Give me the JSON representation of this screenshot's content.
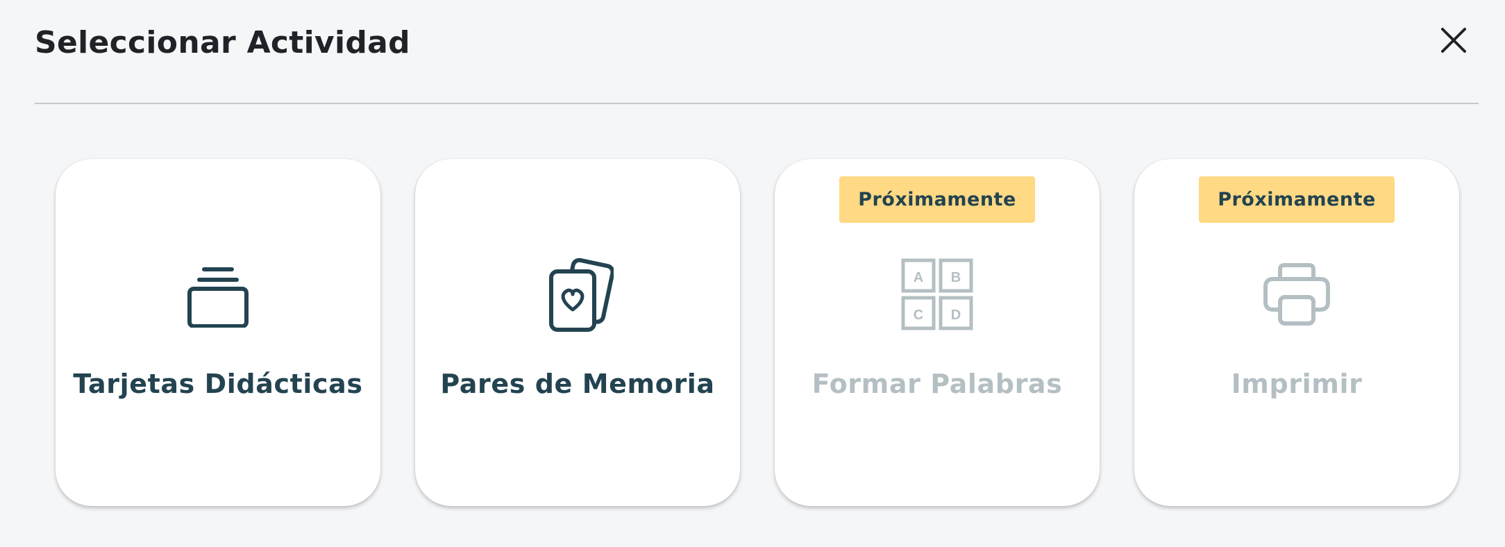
{
  "dialog": {
    "title": "Seleccionar Actividad",
    "close_icon": "close-icon"
  },
  "colors": {
    "background": "#f5f6f8",
    "card": "#ffffff",
    "primary_text": "#234350",
    "disabled_text": "#b4bfc3",
    "badge": "#ffd983"
  },
  "activities": [
    {
      "label": "Tarjetas Didácticas",
      "icon": "stacked-cards-icon",
      "enabled": true,
      "badge": ""
    },
    {
      "label": "Pares de Memoria",
      "icon": "memory-cards-heart-icon",
      "enabled": true,
      "badge": ""
    },
    {
      "label": "Formar Palabras",
      "icon": "letter-tiles-icon",
      "enabled": false,
      "badge": "Próximamente",
      "tiles": [
        "A",
        "B",
        "C",
        "D"
      ]
    },
    {
      "label": "Imprimir",
      "icon": "printer-icon",
      "enabled": false,
      "badge": "Próximamente"
    }
  ]
}
